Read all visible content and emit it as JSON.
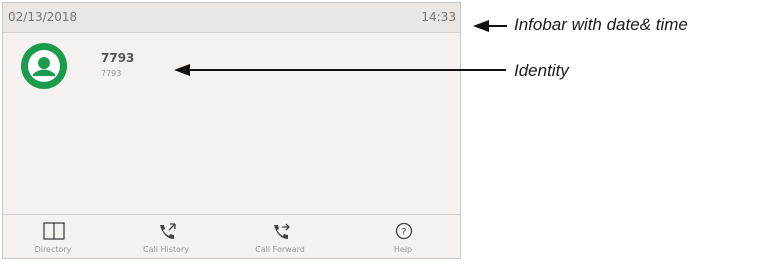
{
  "infobar": {
    "date": "02/13/2018",
    "time": "14:33"
  },
  "identity": {
    "number": "7793",
    "sub_label": "7793",
    "avatar_color": "#1a9c4c"
  },
  "softkeys": [
    {
      "label": "Directory",
      "icon": "directory-icon"
    },
    {
      "label": "Call History",
      "icon": "call-history-icon"
    },
    {
      "label": "Call Forward",
      "icon": "call-forward-icon"
    },
    {
      "label": "Help",
      "icon": "help-icon"
    }
  ],
  "annotations": {
    "infobar_label": "Infobar with date& time",
    "identity_label": "Identity"
  }
}
